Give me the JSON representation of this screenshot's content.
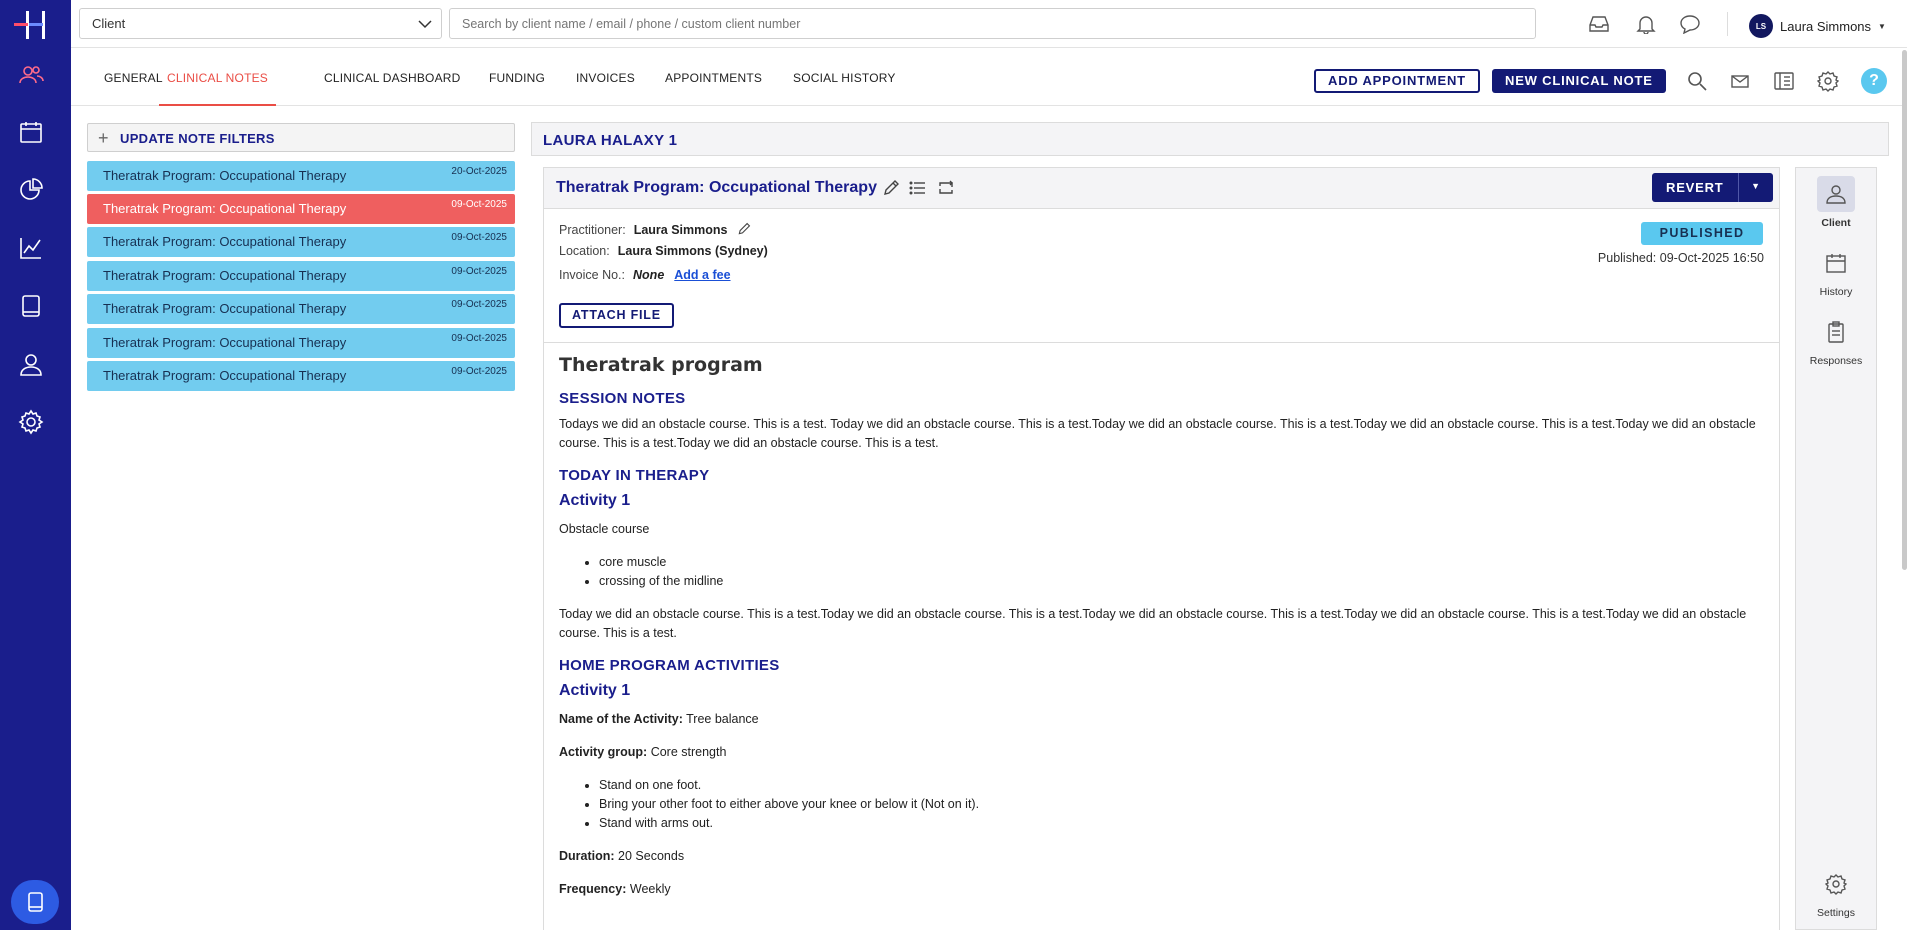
{
  "topbar": {
    "client_select": "Client",
    "search_placeholder": "Search by client name / email / phone / custom client number",
    "user_initials": "LS",
    "user_name": "Laura Simmons"
  },
  "tabs": [
    {
      "label": "GENERAL"
    },
    {
      "label": "CLINICAL NOTES",
      "active": true
    },
    {
      "label": "CLINICAL DASHBOARD"
    },
    {
      "label": "FUNDING"
    },
    {
      "label": "INVOICES"
    },
    {
      "label": "APPOINTMENTS"
    },
    {
      "label": "SOCIAL HISTORY"
    }
  ],
  "actions": {
    "add_appointment": "ADD APPOINTMENT",
    "new_clinical_note": "NEW CLINICAL NOTE",
    "help": "?"
  },
  "filters": {
    "label": "UPDATE NOTE FILTERS"
  },
  "notes": [
    {
      "title": "Theratrak Program: Occupational Therapy",
      "date": "20-Oct-2025"
    },
    {
      "title": "Theratrak Program: Occupational Therapy",
      "date": "09-Oct-2025",
      "active": true
    },
    {
      "title": "Theratrak Program: Occupational Therapy",
      "date": "09-Oct-2025"
    },
    {
      "title": "Theratrak Program: Occupational Therapy",
      "date": "09-Oct-2025"
    },
    {
      "title": "Theratrak Program: Occupational Therapy",
      "date": "09-Oct-2025"
    },
    {
      "title": "Theratrak Program: Occupational Therapy",
      "date": "09-Oct-2025"
    },
    {
      "title": "Theratrak Program: Occupational Therapy",
      "date": "09-Oct-2025"
    }
  ],
  "client_header": "LAURA HALAXY 1",
  "note": {
    "title": "Theratrak Program: Occupational Therapy",
    "revert": "REVERT",
    "practitioner_label": "Practitioner:",
    "practitioner": "Laura Simmons",
    "location_label": "Location:",
    "location": "Laura Simmons (Sydney)",
    "invoice_label": "Invoice No.:",
    "invoice": "None",
    "add_fee": "Add a fee",
    "attach_file": "ATTACH FILE",
    "status": "PUBLISHED",
    "published": "Published: 09-Oct-2025 16:50",
    "body": {
      "heading": "Theratrak program",
      "session_notes_h": "SESSION NOTES",
      "session_notes": "Todays we did an obstacle course. This is a test. Today we did an obstacle course. This is a test.Today we did an obstacle course. This is a test.Today we did an obstacle course. This is a test.Today we did an obstacle course. This is a test.Today we did an obstacle course. This is a test.",
      "today_h": "TODAY IN THERAPY",
      "activity1_h": "Activity 1",
      "activity1_name": "Obstacle course",
      "activity1_bullets": [
        "core muscle",
        "crossing of the midline"
      ],
      "activity1_text": "Today we did an obstacle course. This is a test.Today we did an obstacle course. This is a test.Today we did an obstacle course. This is a test.Today we did an obstacle course. This is a test.Today we did an obstacle course. This is a test.",
      "home_h": "HOME PROGRAM ACTIVITIES",
      "home_activity_h": "Activity 1",
      "name_label": "Name of the Activity:",
      "name_value": "Tree balance",
      "group_label": "Activity group:",
      "group_value": "Core strength",
      "home_bullets": [
        "Stand on one foot.",
        "Bring your other foot to either above your knee or below it (Not on it).",
        "Stand with arms out."
      ],
      "duration_label": "Duration:",
      "duration_value": "20 Seconds",
      "frequency_label": "Frequency:",
      "frequency_value": "Weekly"
    }
  },
  "right_panel": {
    "client": "Client",
    "history": "History",
    "responses": "Responses",
    "settings": "Settings"
  },
  "colors": {
    "rail": "#1a1e8c",
    "brand_navy": "#131a75",
    "accent_red": "#ea4d45",
    "note_blue": "#72ccef",
    "note_active": "#ef5f5f",
    "badge": "#5ac8ef"
  }
}
